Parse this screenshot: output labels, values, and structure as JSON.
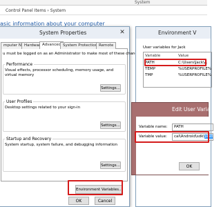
{
  "explorer": {
    "window_title": "System",
    "breadcrumb": "Control Panel Items  ›  System",
    "heading": "asic information about your computer"
  },
  "system_properties": {
    "title": "System Properties",
    "tabs": [
      "mputer Name",
      "Hardware",
      "Advanced",
      "System Protection",
      "Remote"
    ],
    "admin_note": "u must be logged on as an Administrator to make most of these changes.",
    "performance": {
      "label": "Performance",
      "desc": "Visual effects, processor scheduling, memory usage, and virtual memory",
      "button": "Settings..."
    },
    "user_profiles": {
      "label": "User Profiles",
      "desc": "Desktop settings related to your sign-in",
      "button": "Settings..."
    },
    "startup_recovery": {
      "label": "Startup and Recovery",
      "desc": "System startup, system failure, and debugging information",
      "button": "Settings..."
    },
    "env_button": "Environment Variables...",
    "ok": "OK",
    "cancel": "Cancel"
  },
  "environment_variables": {
    "title": "Environment V",
    "user_vars_label": "User variables for Jack",
    "columns": [
      "Variable",
      "Value"
    ],
    "rows": [
      {
        "name": "PATH",
        "value": "C:\\Users\\Jack\\A"
      },
      {
        "name": "TEMP",
        "value": "%USERPROFILE%"
      },
      {
        "name": "TMP",
        "value": "%USERPROFILE%"
      }
    ]
  },
  "edit_user_variable": {
    "title": "Edit User Varia",
    "name_label": "Variable name:",
    "name_value": "PATH",
    "value_label": "Variable value:",
    "value_text": "cal\\Android\\sdk\\",
    "value_selected": "platfo",
    "ok": "OK"
  },
  "colors": {
    "highlight": "#d41a1a",
    "edit_title_bg": "#a86f6f",
    "selection": "#3399ff"
  }
}
